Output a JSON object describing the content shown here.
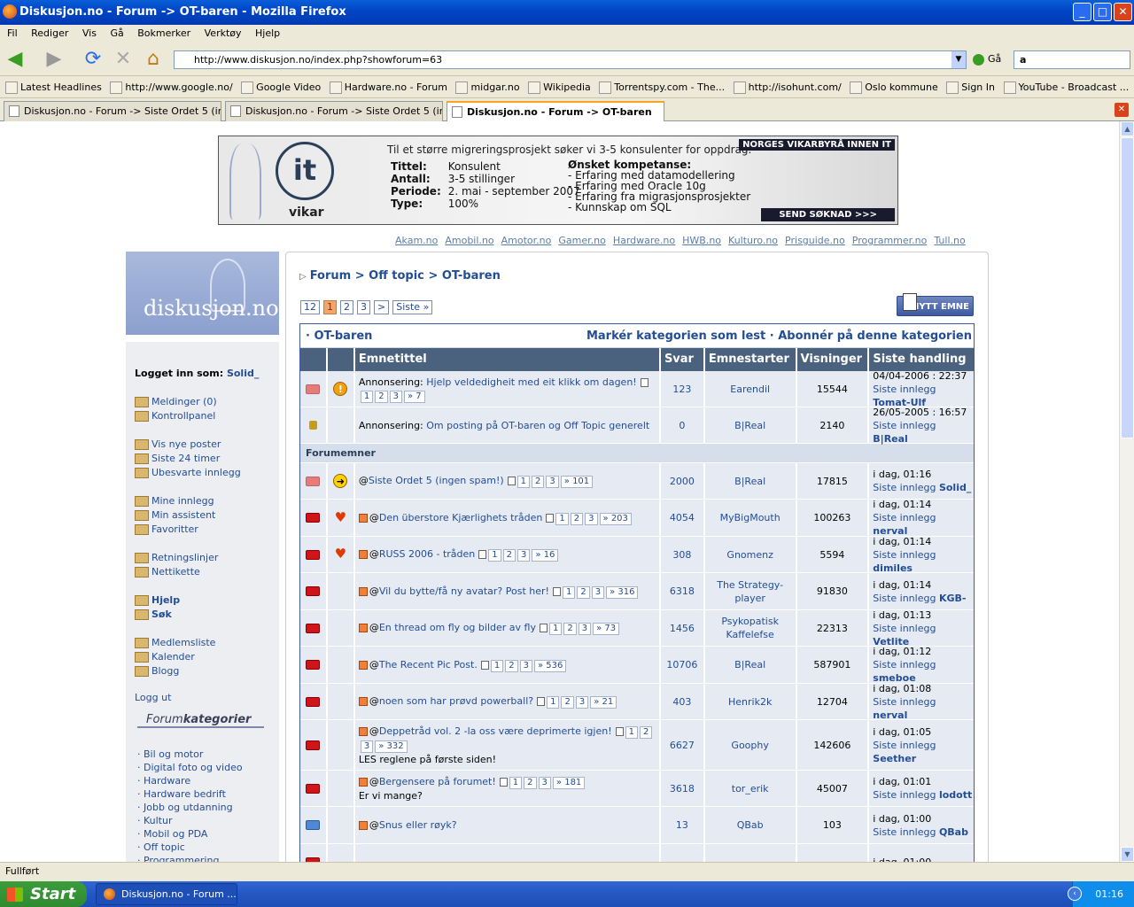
{
  "window": {
    "title": "Diskusjon.no - Forum -> OT-baren - Mozilla Firefox",
    "min": "_",
    "max": "□",
    "close": "✕"
  },
  "menu": [
    "Fil",
    "Rediger",
    "Vis",
    "Gå",
    "Bokmerker",
    "Verktøy",
    "Hjelp"
  ],
  "nav": {
    "back": "◀",
    "forward": "▶",
    "reload": "⟳",
    "stop": "✕",
    "home": "⌂",
    "url": "http://www.diskusjon.no/index.php?showforum=63",
    "go": "Gå",
    "search_engine": "a"
  },
  "bookmarks": [
    {
      "icon": "rss-icon",
      "label": "Latest Headlines"
    },
    {
      "icon": "google-icon",
      "label": "http://www.google.no/"
    },
    {
      "icon": "google-icon",
      "label": "Google Video"
    },
    {
      "icon": "page-icon",
      "label": "Hardware.no - Forum"
    },
    {
      "icon": "page-icon",
      "label": "midgar.no"
    },
    {
      "icon": "wikipedia-icon",
      "label": "Wikipedia"
    },
    {
      "icon": "torrentspy-icon",
      "label": "Torrentspy.com - The..."
    },
    {
      "icon": "isohunt-icon",
      "label": "http://isohunt.com/"
    },
    {
      "icon": "page-icon",
      "label": "Oslo kommune"
    },
    {
      "icon": "page-icon",
      "label": "Sign In"
    },
    {
      "icon": "youtube-icon",
      "label": "YouTube - Broadcast ..."
    }
  ],
  "tabs": [
    {
      "label": "Diskusjon.no - Forum -> Siste Ordet 5 (inge..."
    },
    {
      "label": "Diskusjon.no - Forum -> Siste Ordet 5 (inge..."
    },
    {
      "label": "Diskusjon.no - Forum -> OT-baren"
    }
  ],
  "banner": {
    "brand": "it",
    "brand2": "vikar",
    "headline": "Til et større migreringsprosjekt søker vi 3-5 konsulenter for oppdrag.",
    "rows": [
      {
        "k": "Tittel:",
        "v": "Konsulent"
      },
      {
        "k": "Antall:",
        "v": "3-5 stillinger"
      },
      {
        "k": "Periode:",
        "v": "2. mai - september 2007"
      },
      {
        "k": "Type:",
        "v": "100%"
      }
    ],
    "komp_title": "Ønsket kompetanse:",
    "komp": [
      "- Erfaring med datamodellering",
      "- Erfaring med Oracle 10g",
      "- Erfaring fra migrasjonsprosjekter",
      "- Kunnskap om SQL"
    ],
    "tag": "NORGES VIKARBYRÅ INNEN IT",
    "button": "SEND SØKNAD >>>"
  },
  "sites": [
    "Akam.no",
    "Amobil.no",
    "Amotor.no",
    "Gamer.no",
    "Hardware.no",
    "HWB.no",
    "Kulturo.no",
    "Prisguide.no",
    "Programmer.no",
    "Tull.no"
  ],
  "sidebar": {
    "logo": "diskusjon.no",
    "logged_label": "Logget inn som:",
    "user": "Solid_",
    "groups": [
      [
        "Meldinger (0)",
        "Kontrollpanel"
      ],
      [
        "Vis nye poster",
        "Siste 24 timer",
        "Ubesvarte innlegg"
      ],
      [
        "Mine innlegg",
        "Min assistent",
        "Favoritter"
      ],
      [
        "Retningslinjer",
        "Nettikette"
      ],
      [
        "Hjelp",
        "Søk"
      ],
      [
        "Medlemsliste",
        "Kalender",
        "Blogg"
      ],
      [
        "Logg ut"
      ]
    ],
    "fk_a": "Forum",
    "fk_b": "kategorier",
    "categories": [
      "· Bil og motor",
      "· Digital foto og video",
      "· Hardware",
      "· Hardware bedrift",
      "· Jobb og utdanning",
      "· Kultur",
      "· Mobil og PDA",
      "· Off topic",
      "· Programmering"
    ]
  },
  "breadcrumb": {
    "arrow": "▷",
    "a": "Forum",
    "sep": ">",
    "b": "Off topic",
    "c": "OT-baren"
  },
  "pager": {
    "total": "12",
    "pages": [
      "1",
      "2",
      "3"
    ],
    "next": ">",
    "last": "Siste »"
  },
  "new_topic": "NYTT EMNE",
  "forum": {
    "title": "· OT-baren",
    "actions": "Markér kategorien som lest · Abonnér på denne kategorien",
    "headers": [
      "Emnetittel",
      "Svar",
      "Emnestarter",
      "Visninger",
      "Siste handling"
    ],
    "section": "Forumemner",
    "last_prefix": "Siste innlegg",
    "announcements": [
      {
        "folder": "grey",
        "status": "warn",
        "prefix": "Annonsering: ",
        "title": "Hjelp veldedigheit med eit klikk om dagen!",
        "pages": [
          "1",
          "2",
          "3",
          "» 7"
        ],
        "replies": "123",
        "starter": "Earendil",
        "views": "15544",
        "date": "04/04-2006 : 22:37",
        "last": "Tomat-Ulf"
      },
      {
        "folder": "lock",
        "status": "",
        "prefix": "Annonsering: ",
        "title": "Om posting på OT-baren og Off Topic generelt",
        "pages": [],
        "replies": "0",
        "starter": "B|Real",
        "views": "2140",
        "date": "26/05-2005 : 16:57",
        "last": "B|Real"
      }
    ],
    "topics": [
      {
        "folder": "grey",
        "status": "arrow",
        "pre": false,
        "title": "Siste Ordet 5 (ingen spam!)",
        "extra": "",
        "pages": [
          "1",
          "2",
          "3",
          "» 101"
        ],
        "replies": "2000",
        "starter": "B|Real",
        "views": "17815",
        "date": "i dag, 01:16",
        "last": "Solid_"
      },
      {
        "folder": "red",
        "status": "heart",
        "pre": true,
        "title": "Den überstore Kjærlighets tråden",
        "extra": "",
        "pages": [
          "1",
          "2",
          "3",
          "» 203"
        ],
        "replies": "4054",
        "starter": "MyBigMouth",
        "views": "100263",
        "date": "i dag, 01:14",
        "last": "nerval"
      },
      {
        "folder": "red",
        "status": "heart",
        "pre": true,
        "title": "RUSS 2006 - tråden",
        "extra": "",
        "pages": [
          "1",
          "2",
          "3",
          "» 16"
        ],
        "replies": "308",
        "starter": "Gnomenz",
        "views": "5594",
        "date": "i dag, 01:14",
        "last": "dimiles"
      },
      {
        "folder": "red",
        "status": "",
        "pre": true,
        "title": "Vil du bytte/få ny avatar? Post her!",
        "extra": "",
        "pages": [
          "1",
          "2",
          "3",
          "» 316"
        ],
        "replies": "6318",
        "starter": "The Strategy-player",
        "views": "91830",
        "date": "i dag, 01:14",
        "last": "KGB-"
      },
      {
        "folder": "red",
        "status": "",
        "pre": true,
        "title": "En thread om fly og bilder av fly",
        "extra": "",
        "pages": [
          "1",
          "2",
          "3",
          "» 73"
        ],
        "replies": "1456",
        "starter": "Psykopatisk Kaffelefse",
        "views": "22313",
        "date": "i dag, 01:13",
        "last": "Vetlite"
      },
      {
        "folder": "red",
        "status": "",
        "pre": true,
        "title": "The Recent Pic Post.",
        "extra": "",
        "pages": [
          "1",
          "2",
          "3",
          "» 536"
        ],
        "replies": "10706",
        "starter": "B|Real",
        "views": "587901",
        "date": "i dag, 01:12",
        "last": "smeboe"
      },
      {
        "folder": "red",
        "status": "",
        "pre": true,
        "title": "noen som har prøvd powerball?",
        "extra": "",
        "pages": [
          "1",
          "2",
          "3",
          "» 21"
        ],
        "replies": "403",
        "starter": "Henrik2k",
        "views": "12704",
        "date": "i dag, 01:08",
        "last": "nerval"
      },
      {
        "folder": "red",
        "status": "",
        "pre": true,
        "title": "Deppetråd vol. 2 -la oss være deprimerte igjen!",
        "extra": "LES reglene på første siden!",
        "pages": [
          "1",
          "2",
          "3",
          "» 332"
        ],
        "replies": "6627",
        "starter": "Goophy",
        "views": "142606",
        "date": "i dag, 01:05",
        "last": "Seether"
      },
      {
        "folder": "red",
        "status": "",
        "pre": true,
        "title": "Bergensere på forumet!",
        "extra": "Er vi mange?",
        "pages": [
          "1",
          "2",
          "3",
          "» 181"
        ],
        "replies": "3618",
        "starter": "tor_erik",
        "views": "45007",
        "date": "i dag, 01:01",
        "last": "lodott"
      },
      {
        "folder": "blue",
        "status": "",
        "pre": true,
        "title": "Snus eller røyk?",
        "extra": "",
        "pages": [],
        "replies": "13",
        "starter": "QBab",
        "views": "103",
        "date": "i dag, 01:00",
        "last": "QBab"
      },
      {
        "folder": "red",
        "status": "",
        "pre": false,
        "title": "",
        "extra": "",
        "pages": [],
        "replies": "",
        "starter": "",
        "views": "",
        "date": "i dag, 01:00",
        "last": ""
      }
    ]
  },
  "statusbar": "Fullført",
  "taskbar": {
    "start": "Start",
    "item": "Diskusjon.no - Forum ...",
    "clock": "01:16"
  }
}
